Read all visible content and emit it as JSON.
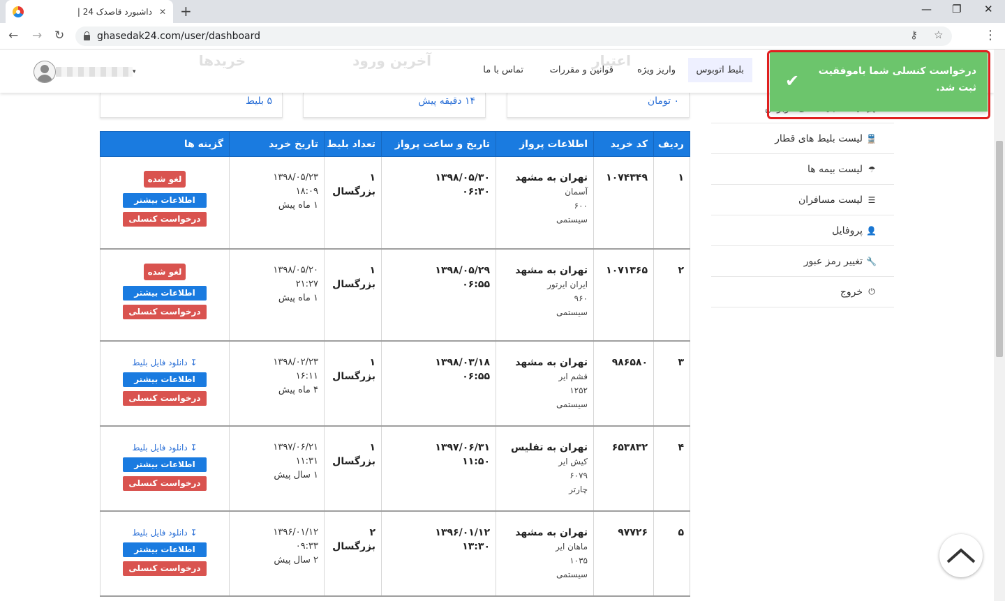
{
  "browser": {
    "tab_title": "داشبورد قاصدک 24 |",
    "url": "ghasedak24.com/user/dashboard",
    "new_tab": "+",
    "tab_close": "✕",
    "back": "←",
    "forward": "→",
    "reload": "↻",
    "min": "—",
    "restore": "❐",
    "close": "✕",
    "key_icon": "⚷",
    "star_icon": "☆",
    "menu": "⋮"
  },
  "header": {
    "nav": [
      "بلیط اتوبوس",
      "واریز ویژه",
      "قوانین و مقررات",
      "تماس با ما"
    ],
    "faded": [
      "خریدها",
      "آخرین ورود",
      "اعتبار"
    ],
    "user_caret": "▾"
  },
  "cards": [
    "۵ بلیط",
    "۱۴ دقیقه پیش",
    "۰ تومان"
  ],
  "sidebar": [
    {
      "icon": "🚌",
      "label": "لیست بلیط های اتوبوس"
    },
    {
      "icon": "🚆",
      "label": "لیست بلیط های قطار"
    },
    {
      "icon": "☂",
      "label": "لیست بیمه ها"
    },
    {
      "icon": "☰",
      "label": "لیست مسافران"
    },
    {
      "icon": "👤",
      "label": "پروفایل"
    },
    {
      "icon": "🔧",
      "label": "تغییر رمز عبور"
    },
    {
      "icon": "⏻",
      "label": "خروج"
    }
  ],
  "table": {
    "headers": [
      "ردیف",
      "کد خرید",
      "اطلاعات پرواز",
      "تاریخ و ساعت پرواز",
      "تعداد بلیط",
      "تاریخ خرید",
      "گزینه ها"
    ],
    "labels": {
      "canceled": "لغو شده",
      "info": "اطلاعات بیشتر",
      "cancel": "درخواست کنسلی",
      "download": "دانلود فایل بلیط"
    },
    "rows": [
      {
        "n": "۱",
        "code": "۱۰۷۴۳۴۹",
        "route": "تهران به مشهد",
        "airline": "آسمان",
        "flight": "۶۰۰",
        "type": "سیستمی",
        "fdate": "۱۳۹۸/۰۵/۳۰",
        "ftime": "۰۶:۳۰",
        "count": "۱ بزرگسال",
        "bdate": "۱۳۹۸/۰۵/۲۳",
        "btime": "۱۸:۰۹",
        "ago": "۱ ماه پیش"
      },
      {
        "n": "۲",
        "code": "۱۰۷۱۳۶۵",
        "route": "تهران به مشهد",
        "airline": "ایران ایرتور",
        "flight": "۹۶۰",
        "type": "سیستمی",
        "fdate": "۱۳۹۸/۰۵/۲۹",
        "ftime": "۰۶:۵۵",
        "count": "۱ بزرگسال",
        "bdate": "۱۳۹۸/۰۵/۲۰",
        "btime": "۲۱:۲۷",
        "ago": "۱ ماه پیش"
      },
      {
        "n": "۳",
        "code": "۹۸۶۵۸۰",
        "route": "تهران به مشهد",
        "airline": "قشم ایر",
        "flight": "۱۲۵۲",
        "type": "سیستمی",
        "fdate": "۱۳۹۸/۰۳/۱۸",
        "ftime": "۰۶:۵۵",
        "count": "۱ بزرگسال",
        "bdate": "۱۳۹۸/۰۲/۲۳",
        "btime": "۱۶:۱۱",
        "ago": "۴ ماه پیش"
      },
      {
        "n": "۴",
        "code": "۶۵۳۸۳۲",
        "route": "تهران به تفلیس",
        "airline": "کیش ایر",
        "flight": "۶۰۷۹",
        "type": "چارتر",
        "fdate": "۱۳۹۷/۰۶/۳۱",
        "ftime": "۱۱:۵۰",
        "count": "۱ بزرگسال",
        "bdate": "۱۳۹۷/۰۶/۲۱",
        "btime": "۱۱:۳۱",
        "ago": "۱ سال پیش"
      },
      {
        "n": "۵",
        "code": "۹۷۷۲۶",
        "route": "تهران به مشهد",
        "airline": "ماهان ایر",
        "flight": "۱۰۳۵",
        "type": "سیستمی",
        "fdate": "۱۳۹۶/۰۱/۱۲",
        "ftime": "۱۳:۳۰",
        "count": "۲ بزرگسال",
        "bdate": "۱۳۹۶/۰۱/۱۲",
        "btime": "۰۹:۳۳",
        "ago": "۲ سال پیش"
      }
    ]
  },
  "toast": {
    "message": "درخواست کنسلی شما باموفقیت ثبت شد.",
    "check": "✔"
  },
  "colors": {
    "primary": "#1a7be0",
    "danger": "#d9534f",
    "success": "#6cc56c",
    "highlight": "#e01f1f"
  }
}
